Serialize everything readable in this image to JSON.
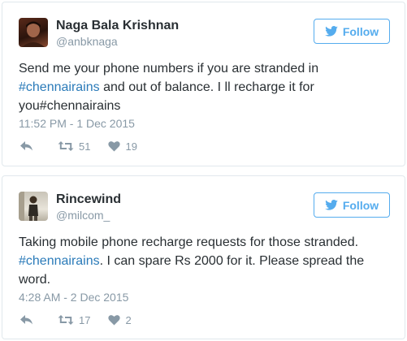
{
  "tweets": [
    {
      "name": "Naga Bala Krishnan",
      "handle": "@anbknaga",
      "follow_label": "Follow",
      "text_parts": [
        "Send me your phone numbers if you are stranded in ",
        "#chennairains",
        " and out of balance. I ll recharge it for you#chennairains"
      ],
      "time": "11:52 PM - 1 Dec 2015",
      "retweets": "51",
      "likes": "19"
    },
    {
      "name": "Rincewind",
      "handle": "@milcom_",
      "follow_label": "Follow",
      "text_parts": [
        "Taking mobile phone recharge requests for those stranded. ",
        "#chennairains",
        ". I can spare Rs 2000 for it. Please spread the word."
      ],
      "time": "4:28 AM - 2 Dec 2015",
      "retweets": "17",
      "likes": "2"
    }
  ],
  "icons": {
    "follow": "twitter-bird-icon",
    "reply": "reply-icon",
    "retweet": "retweet-icon",
    "like": "heart-icon"
  },
  "colors": {
    "accent": "#55acee",
    "hashtag": "#2b7bb9",
    "muted": "#8899a6",
    "text": "#292f33",
    "border": "#e1e8ed"
  }
}
